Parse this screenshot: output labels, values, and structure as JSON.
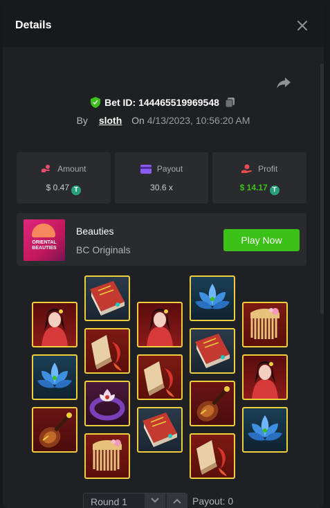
{
  "header": {
    "title": "Details"
  },
  "bet": {
    "id_label": "Bet ID: 144465519969548",
    "by_label": "By",
    "user": "sloth",
    "on_label": "On",
    "datetime": "4/13/2023, 10:56:20 AM"
  },
  "stats": {
    "amount": {
      "label": "Amount",
      "value": "$ 0.47",
      "coin": "T"
    },
    "payout": {
      "label": "Payout",
      "value": "30.6 x"
    },
    "profit": {
      "label": "Profit",
      "value": "$ 14.17",
      "coin": "T"
    }
  },
  "game": {
    "name": "Beauties",
    "provider": "BC Originals",
    "thumb_text": "ORIENTAL BEAUTIES",
    "play_label": "Play Now"
  },
  "round": {
    "label": "Round 1",
    "payout_label": "Payout: 0"
  },
  "reels": [
    [
      "lady",
      "lotus",
      "lute"
    ],
    [
      "book",
      "fish",
      "bracelet",
      "comb"
    ],
    [
      "lady",
      "fish",
      "book"
    ],
    [
      "lotus",
      "book",
      "lute",
      "fish"
    ],
    [
      "comb",
      "lady",
      "lotus"
    ]
  ],
  "colors": {
    "accent": "#3bc117",
    "tile_border": "#f0cf3c",
    "modal_bg": "#1f2023"
  }
}
